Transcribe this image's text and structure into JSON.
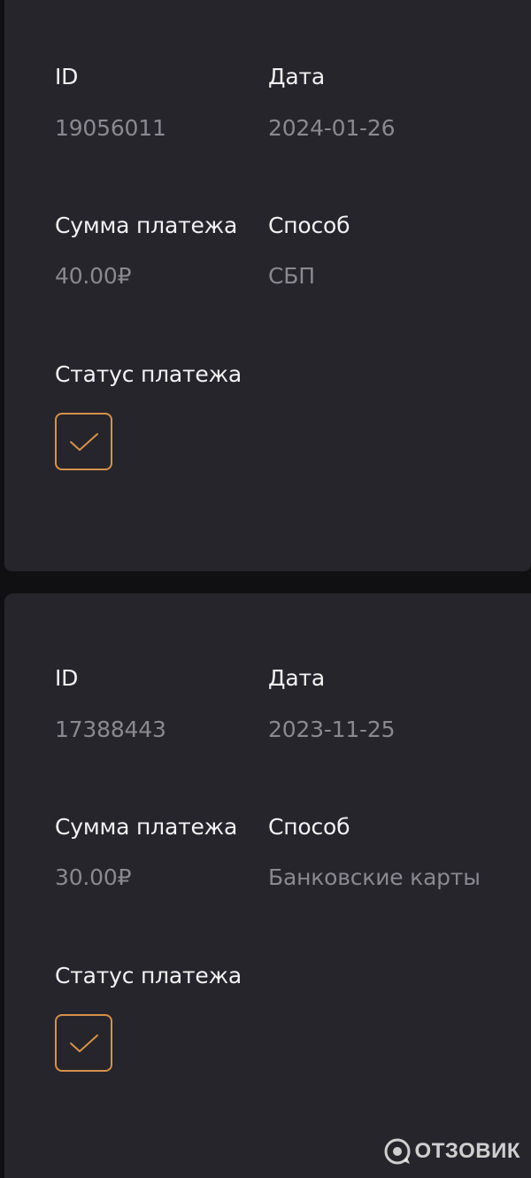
{
  "payments": [
    {
      "id_label": "ID",
      "id_value": "19056011",
      "date_label": "Дата",
      "date_value": "2024-01-26",
      "amount_label": "Сумма платежа",
      "amount_value": "40.00₽",
      "method_label": "Способ",
      "method_value": "СБП",
      "status_label": "Статус платежа",
      "status_icon": "check-icon"
    },
    {
      "id_label": "ID",
      "id_value": "17388443",
      "date_label": "Дата",
      "date_value": "2023-11-25",
      "amount_label": "Сумма платежа",
      "amount_value": "30.00₽",
      "method_label": "Способ",
      "method_value": "Банковские карты",
      "status_label": "Статус платежа",
      "status_icon": "check-icon"
    }
  ],
  "watermark": {
    "text": "ОТЗОВИК",
    "icon": "otzovik-logo-icon"
  },
  "colors": {
    "background": "#101013",
    "card": "#26252b",
    "label": "#f2f2f4",
    "value": "#8a8990",
    "accent": "#d6914a"
  }
}
